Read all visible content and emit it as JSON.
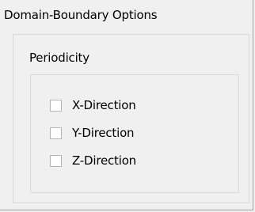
{
  "panel": {
    "title": "Domain-Boundary Options"
  },
  "periodicity": {
    "label": "Periodicity",
    "options": [
      {
        "label": "X-Direction",
        "checked": false
      },
      {
        "label": "Y-Direction",
        "checked": false
      },
      {
        "label": "Z-Direction",
        "checked": false
      }
    ]
  }
}
